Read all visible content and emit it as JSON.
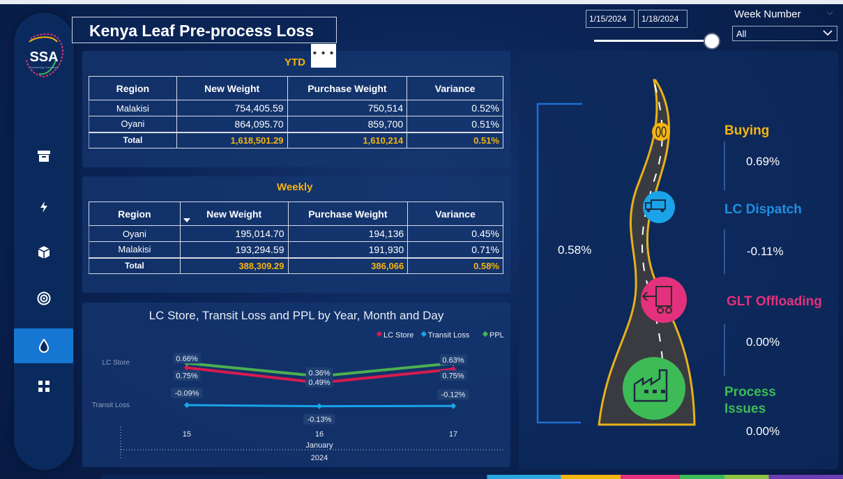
{
  "title": "Kenya Leaf Pre-process Loss",
  "logo": {
    "text": "SSA"
  },
  "filters": {
    "start_date": "1/15/2024",
    "end_date": "1/18/2024",
    "week_label": "Week Number",
    "week_value": "All"
  },
  "ytd": {
    "title": "YTD",
    "more": "• • •",
    "headers": [
      "Region",
      "New Weight",
      "Purchase Weight",
      "Variance"
    ],
    "rows": [
      {
        "region": "Malakisi",
        "new_weight": "754,405.59",
        "purchase_weight": "750,514",
        "variance": "0.52%"
      },
      {
        "region": "Oyani",
        "new_weight": "864,095.70",
        "purchase_weight": "859,700",
        "variance": "0.51%"
      }
    ],
    "total": {
      "region": "Total",
      "new_weight": "1,618,501.29",
      "purchase_weight": "1,610,214",
      "variance": "0.51%"
    }
  },
  "weekly": {
    "title": "Weekly",
    "headers": [
      "Region",
      "New Weight",
      "Purchase Weight",
      "Variance"
    ],
    "rows": [
      {
        "region": "Oyani",
        "new_weight": "195,014.70",
        "purchase_weight": "194,136",
        "variance": "0.45%"
      },
      {
        "region": "Malakisi",
        "new_weight": "193,294.59",
        "purchase_weight": "191,930",
        "variance": "0.71%"
      }
    ],
    "total": {
      "region": "Total",
      "new_weight": "388,309.29",
      "purchase_weight": "386,066",
      "variance": "0.58%"
    }
  },
  "chart_data": {
    "type": "line",
    "title": "LC Store, Transit Loss and PPL by Year, Month and Day",
    "categories": [
      "15",
      "16",
      "17"
    ],
    "x_group_month": "January",
    "x_group_year": "2024",
    "row_labels": [
      "LC Store",
      "Transit Loss"
    ],
    "legend_position": "top-right",
    "series": [
      {
        "name": "LC Store",
        "color": "#d81b4f",
        "values": [
          0.66,
          0.36,
          0.63
        ],
        "labels": [
          "0.66%",
          "0.36%",
          "0.63%"
        ]
      },
      {
        "name": "Transit Loss",
        "color": "#1aa3e8",
        "values": [
          -0.09,
          -0.13,
          -0.12
        ],
        "labels": [
          "-0.09%",
          "-0.13%",
          "-0.12%"
        ]
      },
      {
        "name": "PPL",
        "color": "#4caf50",
        "values": [
          0.75,
          0.49,
          0.75
        ],
        "labels": [
          "0.75%",
          "0.49%",
          "0.75%"
        ]
      }
    ]
  },
  "pipeline": {
    "overall": "0.58%",
    "stages": [
      {
        "name": "Buying",
        "value": "0.69%",
        "color": "#f6b40e",
        "icon": "tobacco-leaf-icon"
      },
      {
        "name": "LC Dispatch",
        "value": "-0.11%",
        "color": "#1f8fe0",
        "icon": "truck-icon"
      },
      {
        "name": "GLT Offloading",
        "value": "0.00%",
        "color": "#e4317d",
        "icon": "offloading-machine-icon"
      },
      {
        "name": "Process Issues",
        "value": "0.00%",
        "color": "#3dbb57",
        "icon": "factory-icon"
      }
    ],
    "process_label_line1": "Process",
    "process_label_line2": "Issues"
  },
  "nav": {
    "items": [
      "archive-icon",
      "bolt-icon",
      "cube-icon",
      "target-icon",
      "drop-icon",
      "grid-icon"
    ],
    "active_index": 4
  }
}
